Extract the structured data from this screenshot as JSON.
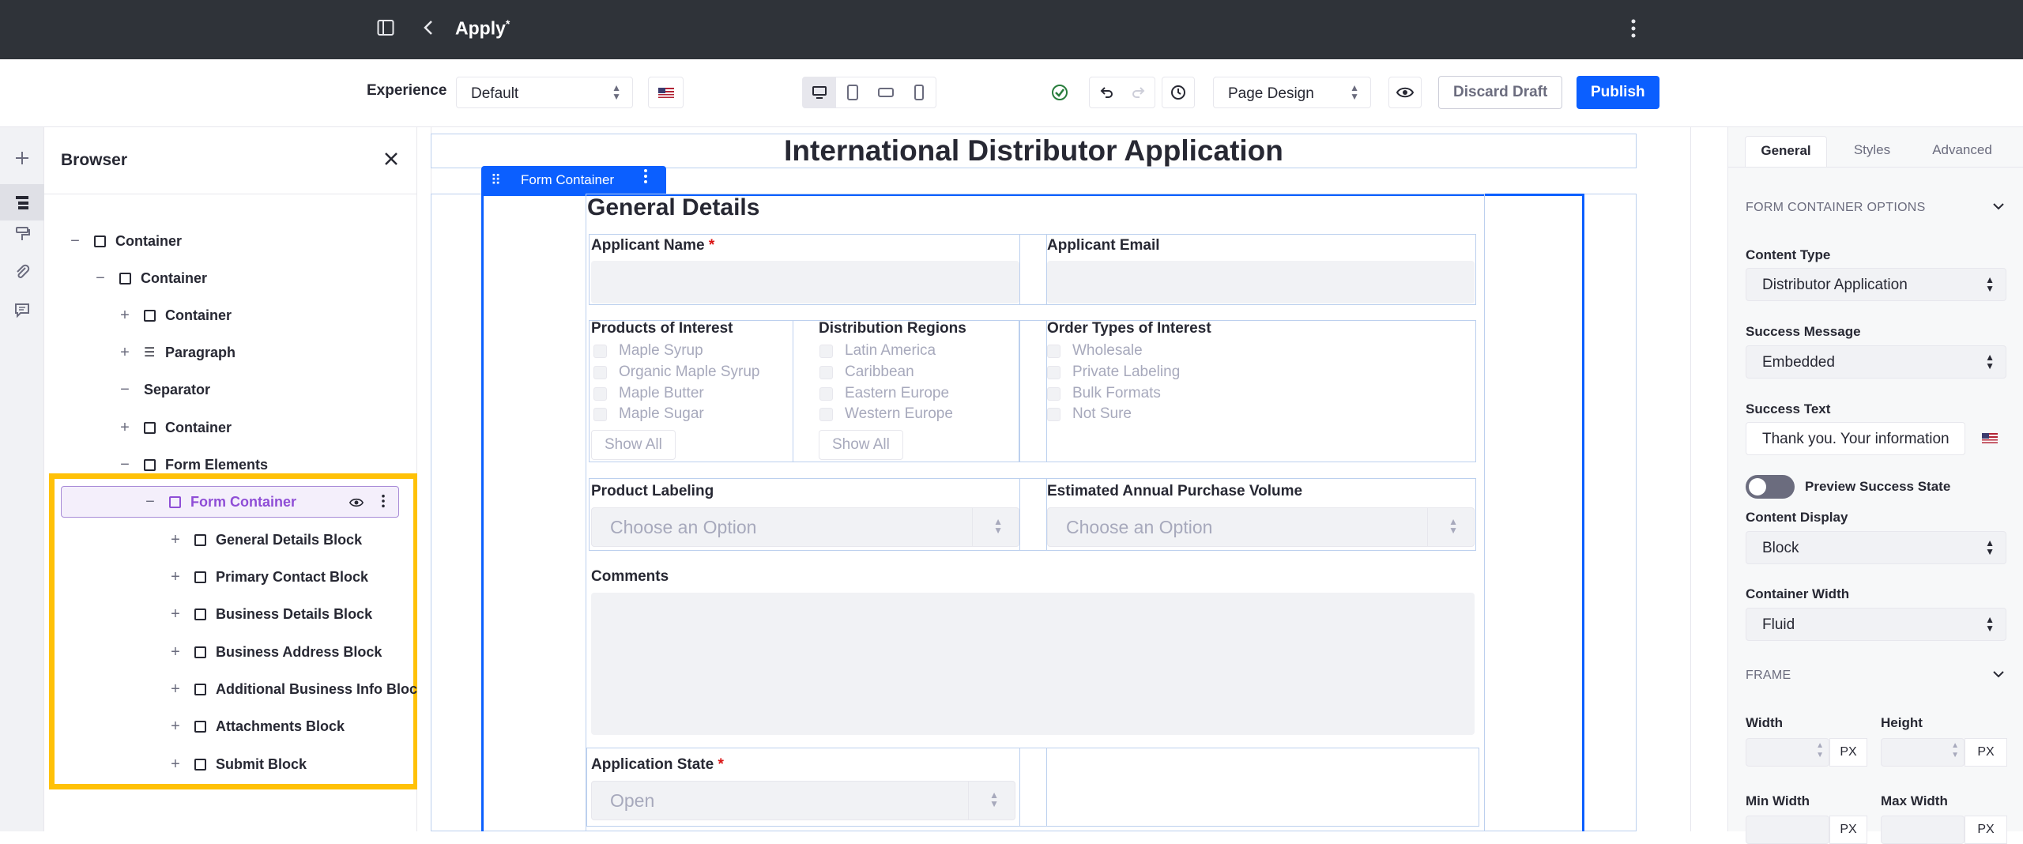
{
  "topbar": {
    "title": "Apply",
    "modified_marker": "*"
  },
  "toolbar": {
    "experience_label": "Experience",
    "experience_value": "Default",
    "mode_value": "Page Design",
    "discard_label": "Discard Draft",
    "publish_label": "Publish"
  },
  "browser": {
    "title": "Browser",
    "tree": [
      {
        "label": "Container",
        "toggle": "−",
        "icon": "box"
      },
      {
        "label": "Container",
        "toggle": "−",
        "icon": "box"
      },
      {
        "label": "Container",
        "toggle": "+",
        "icon": "box"
      },
      {
        "label": "Paragraph",
        "toggle": "+",
        "icon": "paragraph"
      },
      {
        "label": "Separator",
        "toggle": "−",
        "icon": "none"
      },
      {
        "label": "Container",
        "toggle": "+",
        "icon": "box"
      },
      {
        "label": "Form Elements",
        "toggle": "−",
        "icon": "box"
      },
      {
        "label": "Form Container",
        "toggle": "−",
        "icon": "box",
        "selected": true
      },
      {
        "label": "General Details Block",
        "toggle": "+",
        "icon": "box"
      },
      {
        "label": "Primary Contact Block",
        "toggle": "+",
        "icon": "box"
      },
      {
        "label": "Business Details Block",
        "toggle": "+",
        "icon": "box"
      },
      {
        "label": "Business Address Block",
        "toggle": "+",
        "icon": "box"
      },
      {
        "label": "Additional Business Info Block",
        "toggle": "+",
        "icon": "box"
      },
      {
        "label": "Attachments Block",
        "toggle": "+",
        "icon": "box"
      },
      {
        "label": "Submit Block",
        "toggle": "+",
        "icon": "box"
      }
    ]
  },
  "canvas": {
    "page_title": "International Distributor Application",
    "form_container_tag": "Form Container",
    "section_title": "General Details",
    "applicant_name_label": "Applicant Name",
    "applicant_email_label": "Applicant Email",
    "products_label": "Products of Interest",
    "products": [
      "Maple Syrup",
      "Organic Maple Syrup",
      "Maple Butter",
      "Maple Sugar"
    ],
    "regions_label": "Distribution Regions",
    "regions": [
      "Latin America",
      "Caribbean",
      "Eastern Europe",
      "Western Europe"
    ],
    "order_types_label": "Order Types of Interest",
    "order_types": [
      "Wholesale",
      "Private Labeling",
      "Bulk Formats",
      "Not Sure"
    ],
    "show_all": "Show All",
    "labeling_label": "Product Labeling",
    "volume_label": "Estimated Annual Purchase Volume",
    "choose_option": "Choose an Option",
    "comments_label": "Comments",
    "app_state_label": "Application State",
    "app_state_value": "Open",
    "required_marker": "*"
  },
  "right_panel": {
    "tabs": [
      "General",
      "Styles",
      "Advanced"
    ],
    "section_options": "FORM CONTAINER OPTIONS",
    "content_type_label": "Content Type",
    "content_type_value": "Distributor Application",
    "success_message_label": "Success Message",
    "success_message_value": "Embedded",
    "success_text_label": "Success Text",
    "success_text_value": "Thank you. Your information",
    "preview_label": "Preview Success State",
    "content_display_label": "Content Display",
    "content_display_value": "Block",
    "container_width_label": "Container Width",
    "container_width_value": "Fluid",
    "frame_section": "FRAME",
    "width_label": "Width",
    "height_label": "Height",
    "min_width_label": "Min Width",
    "max_width_label": "Max Width",
    "unit": "PX"
  },
  "colors": {
    "primary": "#0b5fff",
    "topbar": "#2f3339",
    "highlight": "#ffc107",
    "selected_tree": "#8f4ed6",
    "success": "#287d3c"
  }
}
